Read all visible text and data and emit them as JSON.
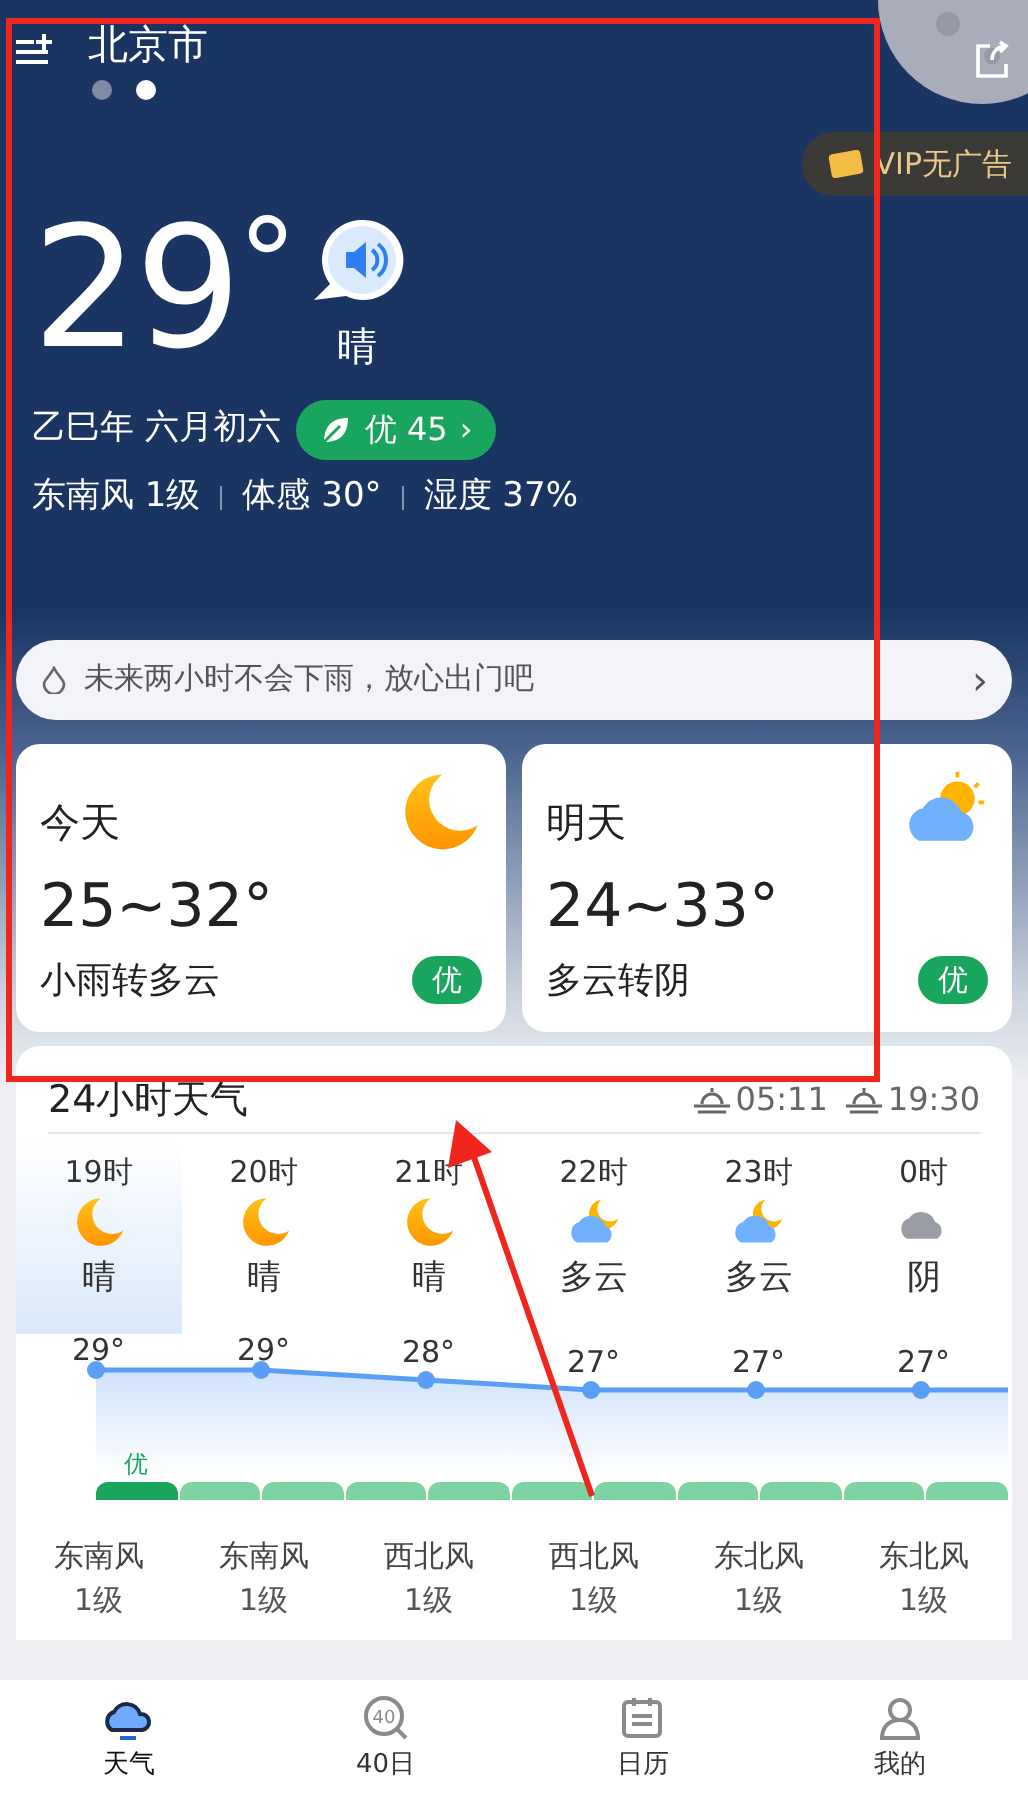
{
  "header": {
    "city": "北京市",
    "pages": [
      {
        "selected": false
      },
      {
        "selected": true
      }
    ]
  },
  "vip": {
    "label": "VIP无广告"
  },
  "current": {
    "temp": "29",
    "unit": "°",
    "condition": "晴",
    "lunar": "乙巳年 六月初六",
    "aqi": {
      "label": "优 45",
      "arrow": "›"
    },
    "details": [
      "东南风 1级",
      "体感 30°",
      "湿度 37%"
    ]
  },
  "rain_notice": {
    "text": "未来两小时不会下雨，放心出门吧",
    "arrow": "›"
  },
  "days": [
    {
      "label": "今天",
      "range": "25~32°",
      "condition": "小雨转多云",
      "aqi": "优",
      "kind": "moon"
    },
    {
      "label": "明天",
      "range": "24~33°",
      "condition": "多云转阴",
      "aqi": "优",
      "kind": "sun-cloud"
    }
  ],
  "hourly": {
    "title": "24小时天气",
    "sunrise": "05:11",
    "sunset": "19:30",
    "items": [
      {
        "hour": "19时",
        "kind": "moon",
        "condition": "晴",
        "temp": "29°",
        "wind": "东南风",
        "level_text": "1级",
        "selected": true
      },
      {
        "hour": "20时",
        "kind": "moon",
        "condition": "晴",
        "temp": "29°",
        "wind": "东南风",
        "level_text": "1级",
        "selected": false
      },
      {
        "hour": "21时",
        "kind": "moon",
        "condition": "晴",
        "temp": "28°",
        "wind": "西北风",
        "level_text": "1级",
        "selected": false
      },
      {
        "hour": "22时",
        "kind": "moon-cloud",
        "condition": "多云",
        "temp": "27°",
        "wind": "西北风",
        "level_text": "1级",
        "selected": false
      },
      {
        "hour": "23时",
        "kind": "moon-cloud",
        "condition": "多云",
        "temp": "27°",
        "wind": "东北风",
        "level_text": "1级",
        "selected": false
      },
      {
        "hour": "0时",
        "kind": "cloud",
        "condition": "阴",
        "temp": "27°",
        "wind": "东北风",
        "level_text": "1级",
        "selected": false
      }
    ],
    "aqi_label": "优",
    "aqi_segments": [
      {
        "selected": true
      },
      {
        "selected": false
      },
      {
        "selected": false
      },
      {
        "selected": false
      },
      {
        "selected": false
      },
      {
        "selected": false
      },
      {
        "selected": false
      },
      {
        "selected": false
      },
      {
        "selected": false
      },
      {
        "selected": false
      },
      {
        "selected": false
      }
    ]
  },
  "nav": [
    {
      "label": "天气",
      "kind": "cloud",
      "selected": true
    },
    {
      "label": "40日",
      "kind": "forty",
      "icon_text": "40",
      "selected": false
    },
    {
      "label": "日历",
      "kind": "calendar",
      "selected": false
    },
    {
      "label": "我的",
      "kind": "user",
      "selected": false
    }
  ]
}
